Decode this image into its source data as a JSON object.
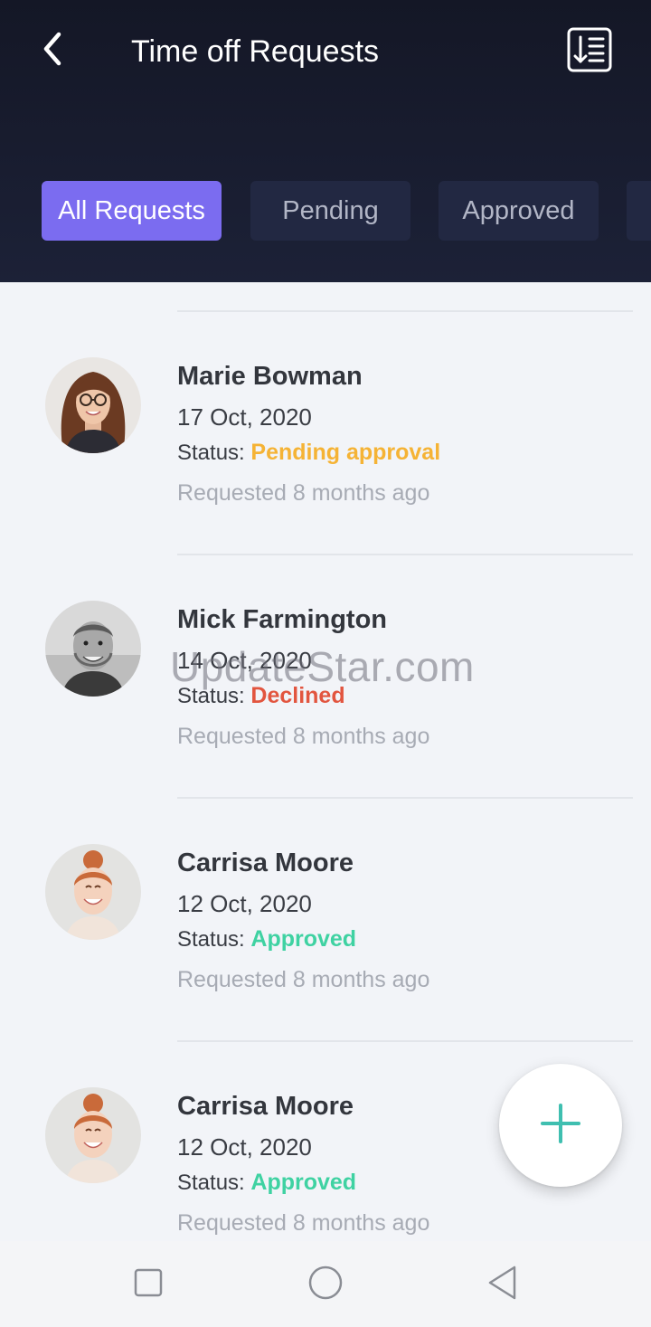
{
  "header": {
    "title": "Time off Requests",
    "back_icon": "chevron-left-icon",
    "sort_icon": "sort-list-icon"
  },
  "tabs": [
    {
      "label": "All Requests",
      "active": true
    },
    {
      "label": "Pending",
      "active": false
    },
    {
      "label": "Approved",
      "active": false
    }
  ],
  "requests": [
    {
      "name": "Marie Bowman",
      "date": "17 Oct, 2020",
      "status_label": "Status:",
      "status": "Pending approval",
      "status_color": "#f5b335",
      "requested": "Requested 8 months ago"
    },
    {
      "name": "Mick Farmington",
      "date": "14 Oct, 2020",
      "status_label": "Status:",
      "status": "Declined",
      "status_color": "#e2553f",
      "requested": "Requested 8 months ago"
    },
    {
      "name": "Carrisa Moore",
      "date": "12 Oct, 2020",
      "status_label": "Status:",
      "status": "Approved",
      "status_color": "#3fd2a2",
      "requested": "Requested 8 months ago"
    },
    {
      "name": "Carrisa Moore",
      "date": "12 Oct, 2020",
      "status_label": "Status:",
      "status": "Approved",
      "status_color": "#3fd2a2",
      "requested": "Requested 8 months ago"
    }
  ],
  "watermark": "UpdateStar.com",
  "fab": {
    "icon": "plus-icon",
    "color": "#3fbfb0"
  },
  "navbar": {
    "icons": [
      "recent-apps-icon",
      "home-icon",
      "back-triangle-icon"
    ]
  },
  "colors": {
    "header_bg": "#1a1e31",
    "accent": "#7b6cf0",
    "pending": "#f5b335",
    "declined": "#e2553f",
    "approved": "#3fd2a2"
  }
}
